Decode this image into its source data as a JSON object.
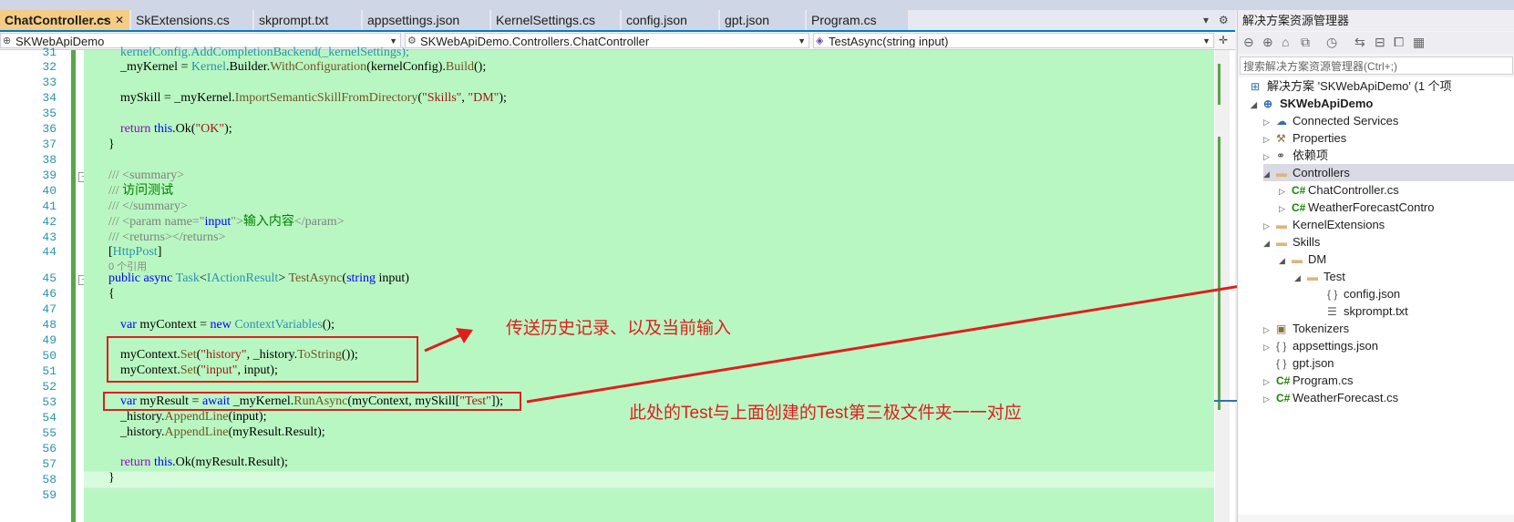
{
  "tabs": [
    "ChatController.cs",
    "SkExtensions.cs",
    "skprompt.txt",
    "appsettings.json",
    "KernelSettings.cs",
    "config.json",
    "gpt.json",
    "Program.cs"
  ],
  "tab_pin_icon": "⊸",
  "tab_close_icon": "✕",
  "navbar": {
    "project": "SKWebApiDemo",
    "type": "SKWebApiDemo.Controllers.ChatController",
    "member": "TestAsync(string input)"
  },
  "line_numbers": [
    "31",
    "32",
    "33",
    "34",
    "35",
    "36",
    "37",
    "38",
    "39",
    "40",
    "41",
    "42",
    "43",
    "44",
    "45",
    "46",
    "47",
    "48",
    "49",
    "50",
    "51",
    "52",
    "53",
    "54",
    "55",
    "56",
    "57",
    "58",
    "59"
  ],
  "code": {
    "l31": "kernelConfig.AddCompletionBackend(_kernelSettings);",
    "l32a": "_myKernel = ",
    "l32b": "Kernel",
    "l32c": ".Builder.",
    "l32d": "WithConfiguration",
    "l32e": "(kernelConfig).",
    "l32f": "Build",
    "l32g": "();",
    "l34a": "mySkill = _myKernel.",
    "l34b": "ImportSemanticSkillFromDirectory",
    "l34c": "(",
    "l34d": "\"Skills\"",
    "l34e": ", ",
    "l34f": "\"DM\"",
    "l34g": ");",
    "l36a": "return ",
    "l36b": "this",
    "l36c": ".Ok(",
    "l36d": "\"OK\"",
    "l36e": ");",
    "l37": "}",
    "l39": "/// <summary>",
    "l40a": "/// ",
    "l40b": "访问测试",
    "l41": "/// </summary>",
    "l42a": "/// <param name=\"",
    "l42b": "input",
    "l42c": "\">",
    "l42d": "输入内容",
    "l42e": "</param>",
    "l43": "/// <returns></returns>",
    "l44a": "[",
    "l44b": "HttpPost",
    "l44c": "]",
    "refs": "0 个引用",
    "l45a": "public async ",
    "l45b": "Task",
    "l45c": "<",
    "l45d": "IActionResult",
    "l45e": "> ",
    "l45f": "TestAsync",
    "l45g": "(",
    "l45h": "string",
    "l45i": " input)",
    "l46": "{",
    "l48a": "var",
    "l48b": " myContext = ",
    "l48c": "new",
    "l48d": " ",
    "l48e": "ContextVariables",
    "l48f": "();",
    "l50a": "myContext.",
    "l50b": "Set",
    "l50c": "(",
    "l50d": "\"history\"",
    "l50e": ", _history.",
    "l50f": "ToString",
    "l50g": "());",
    "l51a": "myContext.",
    "l51b": "Set",
    "l51c": "(",
    "l51d": "\"input\"",
    "l51e": ", input);",
    "l53a": "var",
    "l53b": " myResult = ",
    "l53c": "await",
    "l53d": " _myKernel.",
    "l53e": "RunAsync",
    "l53f": "(myContext, mySkill[",
    "l53g": "\"Test\"",
    "l53h": "]);",
    "l54a": "_history.",
    "l54b": "AppendLine",
    "l54c": "(input);",
    "l55a": "_history.",
    "l55b": "AppendLine",
    "l55c": "(myResult.Result);",
    "l57a": "return ",
    "l57b": "this",
    "l57c": ".Ok(myResult.Result);",
    "l58": "}"
  },
  "annotations": {
    "history": "传送历史记录、以及当前输入",
    "test_folder": "此处的Test与上面创建的Test第三极文件夹一一对应"
  },
  "solution_explorer": {
    "title": "解决方案资源管理器",
    "search_placeholder": "搜索解决方案资源管理器(Ctrl+;)",
    "solution": "解决方案 'SKWebApiDemo' (1 个项",
    "project": "SKWebApiDemo",
    "items": [
      "Connected Services",
      "Properties",
      "依赖项",
      "Controllers",
      "ChatController.cs",
      "WeatherForecastContro",
      "KernelExtensions",
      "Skills",
      "DM",
      "Test",
      "config.json",
      "skprompt.txt",
      "Tokenizers",
      "appsettings.json",
      "gpt.json",
      "Program.cs",
      "WeatherForecast.cs"
    ]
  },
  "colors": {
    "accent": "#007acc",
    "active_tab": "#f5cc84",
    "modified_bg": "#b9f7c2",
    "annotation": "#e01e1e"
  }
}
